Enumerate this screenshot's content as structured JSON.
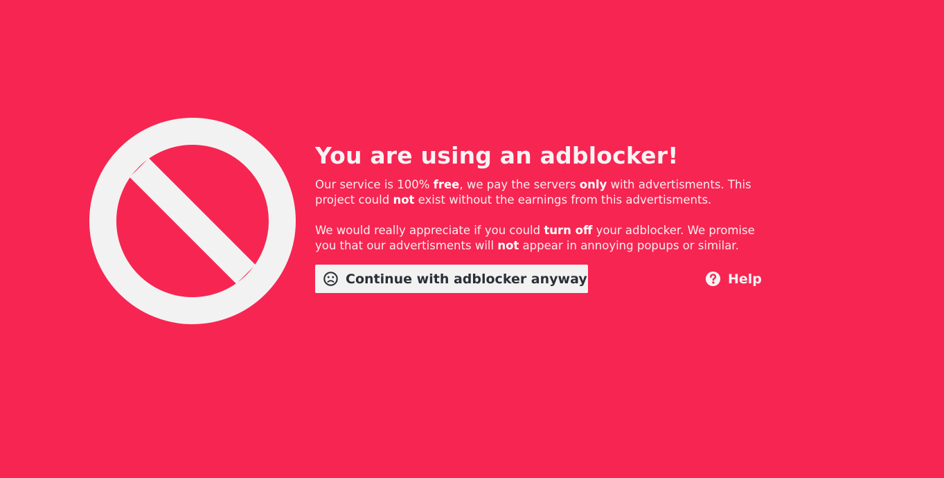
{
  "colors": {
    "background": "#f72552",
    "icon": "#f2f2f2",
    "button_bg": "#f2f2f2",
    "button_text": "#2b2f36",
    "text": "#f7f3f4"
  },
  "icons": {
    "main": "prohibited-sign-icon",
    "continue": "sad-face-icon",
    "help": "question-circle-icon"
  },
  "heading": "You are using an adblocker!",
  "paragraph1": {
    "p1": "Our service is 100% ",
    "b1": "free",
    "p2": ", we pay the servers ",
    "b2": "only",
    "p3": " with advertisments. This project could ",
    "b3": "not",
    "p4": " exist without the earnings from this advertisments."
  },
  "paragraph2": {
    "p1": "We would really appreciate if you could ",
    "b1": "turn off",
    "p2": " your adblocker. We promise you that our advertisments will ",
    "b2": "not",
    "p3": " appear in annoying popups or similar."
  },
  "buttons": {
    "continue_label": "Continue with adblocker anyway",
    "help_label": "Help"
  }
}
